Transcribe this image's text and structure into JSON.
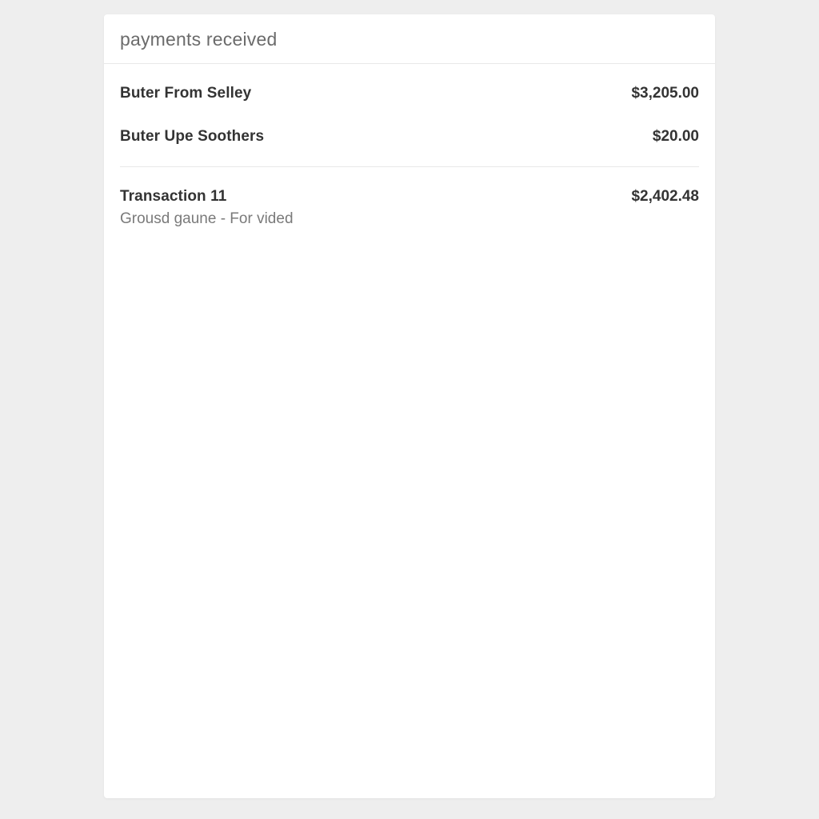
{
  "header": {
    "title": "payments received"
  },
  "payments": [
    {
      "title": "Buter From Selley",
      "subtitle": "",
      "amount": "$3,205.00"
    },
    {
      "title": "Buter Upe Soothers",
      "subtitle": "",
      "amount": "$20.00"
    },
    {
      "title": "Transaction 11",
      "subtitle": "Grousd gaune - For vided",
      "amount": "$2,402.48"
    }
  ]
}
